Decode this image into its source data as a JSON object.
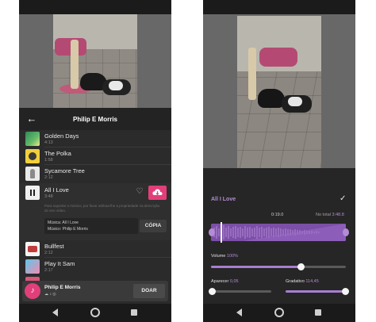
{
  "left": {
    "header": {
      "title": "Philip E Morris"
    },
    "tracks": [
      {
        "title": "Golden Days",
        "duration": "4:13",
        "thumb": "golden"
      },
      {
        "title": "The Polka",
        "duration": "1:58",
        "thumb": "polka"
      },
      {
        "title": "Sycamore Tree",
        "duration": "2:12",
        "thumb": "syc"
      }
    ],
    "active": {
      "title": "All I Love",
      "duration": "3:48",
      "notice": "Para suportar o músico, por favor atribua-lhe a propriedade na descrição do seu vídeo.",
      "credit_music": "Música: All I Love",
      "credit_musician": "Músico: Philip E Morris",
      "copy_label": "CÓPIA"
    },
    "tracks_after": [
      {
        "title": "Bullfest",
        "duration": "2:12",
        "thumb": "bull"
      },
      {
        "title": "Play It Sam",
        "duration": "2:17",
        "thumb": "play"
      }
    ],
    "donate": {
      "name": "Philip E Morris",
      "socials": "☁ ♪ ◎",
      "button": "DOAR"
    }
  },
  "right": {
    "editor": {
      "title": "All I Love",
      "current_time": "0:19.0",
      "total_label": "No total",
      "total_value": "3:48.8",
      "volume_label": "Volume",
      "volume_value": "100%",
      "volume_level": 0.86,
      "fade_in_label": "Aparecer",
      "fade_in_value": "0,05",
      "fade_out_label": "Gradativo",
      "fade_out_value": "114,45"
    }
  },
  "colors": {
    "accent_purple": "#b48bd6",
    "accent_pink": "#e23f7a",
    "panel_dark": "#2b2b2b"
  },
  "icons": [
    "back-arrow-icon",
    "pause-icon",
    "heart-icon",
    "download-cloud-icon",
    "check-icon",
    "nav-back-icon",
    "nav-home-icon",
    "nav-recent-icon"
  ]
}
